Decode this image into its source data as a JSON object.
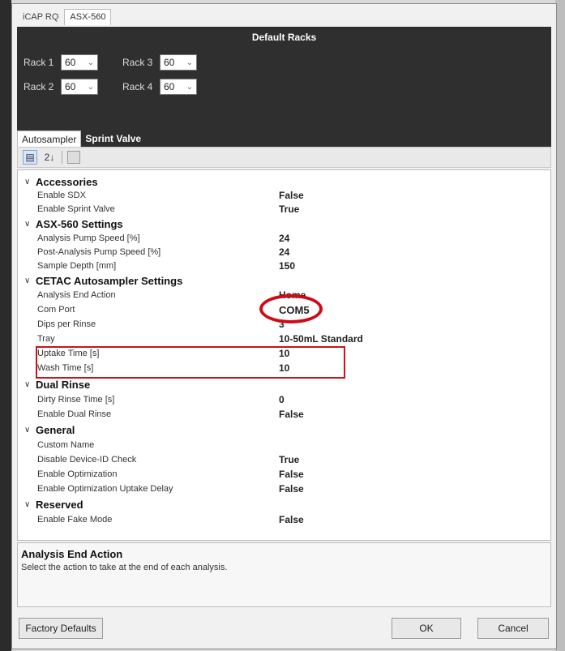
{
  "tabs": [
    "iCAP RQ",
    "ASX-560"
  ],
  "racks": {
    "title": "Default Racks",
    "items": [
      {
        "label": "Rack 1",
        "value": "60"
      },
      {
        "label": "Rack 3",
        "value": "60"
      },
      {
        "label": "Rack 2",
        "value": "60"
      },
      {
        "label": "Rack 4",
        "value": "60"
      }
    ]
  },
  "subtabs": [
    "Autosampler",
    "Sprint Valve"
  ],
  "toolbar": {
    "categorized_icon": "▤",
    "alpha_icon": "2↓"
  },
  "categories": {
    "accessories": "Accessories",
    "asx": "ASX-560 Settings",
    "cetac": "CETAC Autosampler Settings",
    "dual": "Dual Rinse",
    "general": "General",
    "reserved": "Reserved"
  },
  "props": {
    "enable_sdx": {
      "name": "Enable SDX",
      "value": "False"
    },
    "enable_sprint": {
      "name": "Enable Sprint Valve",
      "value": "True"
    },
    "analysis_pump": {
      "name": "Analysis Pump Speed [%]",
      "value": "24"
    },
    "post_pump": {
      "name": "Post-Analysis Pump Speed [%]",
      "value": "24"
    },
    "sample_depth": {
      "name": "Sample Depth [mm]",
      "value": "150"
    },
    "end_action": {
      "name": "Analysis End Action",
      "value": "Home"
    },
    "com_port": {
      "name": "Com Port",
      "value": "COM5"
    },
    "dips": {
      "name": "Dips per Rinse",
      "value": "3"
    },
    "tray": {
      "name": "Tray",
      "value": "10-50mL Standard"
    },
    "uptake": {
      "name": "Uptake Time [s]",
      "value": "10"
    },
    "wash": {
      "name": "Wash Time [s]",
      "value": "10"
    },
    "dirty_rinse": {
      "name": "Dirty Rinse Time [s]",
      "value": "0"
    },
    "enable_dual": {
      "name": "Enable Dual Rinse",
      "value": "False"
    },
    "custom_name": {
      "name": "Custom Name",
      "value": ""
    },
    "disable_device": {
      "name": "Disable Device-ID Check",
      "value": "True"
    },
    "enable_opt": {
      "name": "Enable Optimization",
      "value": "False"
    },
    "enable_opt_delay": {
      "name": "Enable Optimization Uptake Delay",
      "value": "False"
    },
    "enable_fake": {
      "name": "Enable Fake Mode",
      "value": "False"
    }
  },
  "description": {
    "title": "Analysis End Action",
    "text": "Select the action to take at the end of each analysis."
  },
  "buttons": {
    "factory": "Factory Defaults",
    "ok": "OK",
    "cancel": "Cancel"
  }
}
